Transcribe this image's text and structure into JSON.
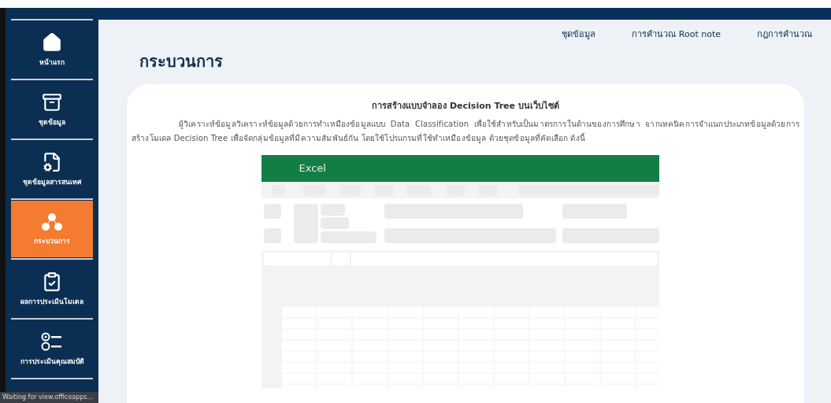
{
  "sidebar": {
    "items": [
      {
        "label": "หน้าแรก",
        "selected": false
      },
      {
        "label": "ชุดข้อมูล",
        "selected": false
      },
      {
        "label": "ชุดข้อมูลสารสนเทศ",
        "selected": false
      },
      {
        "label": "กระบวนการ",
        "selected": true
      },
      {
        "label": "ผลการประเมินโมเดล",
        "selected": false
      },
      {
        "label": "การประเมินคุณสมบัติ",
        "selected": false
      }
    ]
  },
  "status_bar": {
    "text": "Waiting for view.officeapps..."
  },
  "nav": [
    "ชุดข้อมูล",
    "การคำนวณ Root note",
    "กฎการคำนวณ"
  ],
  "page_title": "กระบวนการ",
  "card": {
    "heading": "การสร้างแบบจำลอง Decision Tree บนเว็บไซต์",
    "paragraph": "ผู้วิเคราะห์ข้อมูลวิเคราะห์ข้อมูลด้วยการทำเหมืองข้อมูลแบบ Data Classification เพื่อใช้สำหรับเป็นมาตรการในด้านของการศึกษา จากเทคนิคการจำแนกประเภทข้อมูลด้วยการสร้างโมเดล Decision Tree เพื่อจัดกลุ่มข้อมูลที่มีความสัมพันธ์กัน โดยใช้โปรแกรมที่ใช้ทำเหมืองข้อมูล ด้วยชุดข้อมูลที่คัดเลือก ดังนี้",
    "embed": {
      "app_name": "Excel"
    }
  }
}
